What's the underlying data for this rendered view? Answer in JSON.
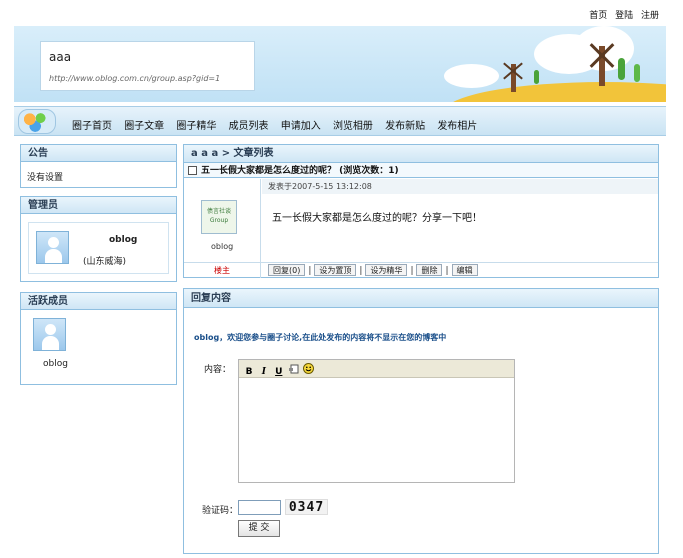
{
  "top_links": [
    "首页",
    "登陆",
    "注册"
  ],
  "banner": {
    "title": "aaa",
    "url": "http://www.oblog.com.cn/group.asp?gid=1"
  },
  "nav": {
    "items": [
      "圈子首页",
      "圈子文章",
      "圈子精华",
      "成员列表",
      "申请加入",
      "浏览相册",
      "发布新贴",
      "发布相片"
    ]
  },
  "sidebar": {
    "notice": {
      "title": "公告",
      "text": "没有设置"
    },
    "admin": {
      "title": "管理员",
      "name": "oblog",
      "location": "(山东威海)"
    },
    "active": {
      "title": "活跃成员",
      "member": "oblog"
    }
  },
  "article": {
    "breadcrumb": "a a a > 文章列表",
    "title": "五一长假大家都是怎么度过的呢？ (浏览次数：1)",
    "meta": "发表于2007-5-15 13:12:08",
    "group_logo_lines": [
      "债言社谈",
      "Group"
    ],
    "author": "oblog",
    "role": "楼主",
    "content": "五一长假大家都是怎么度过的呢？分享一下吧！",
    "actions": [
      "回复(0)",
      "设为置顶",
      "设为精华",
      "删除",
      "编辑"
    ]
  },
  "reply": {
    "title": "回复内容",
    "welcome": "oblog，欢迎您参与圈子讨论,在此处发布的内容将不显示在您的博客中",
    "content_label": "内容：",
    "toolbar": [
      "B",
      "I",
      "U"
    ],
    "captcha_label": "验证码：",
    "captcha_value": "",
    "captcha_text": "0347",
    "submit_label": "提 交"
  },
  "colors": {
    "border": "#8fbfe0",
    "header_bg": "#cfe6f5",
    "role_red": "#cc0000",
    "welcome_blue": "#1a4f8a"
  }
}
